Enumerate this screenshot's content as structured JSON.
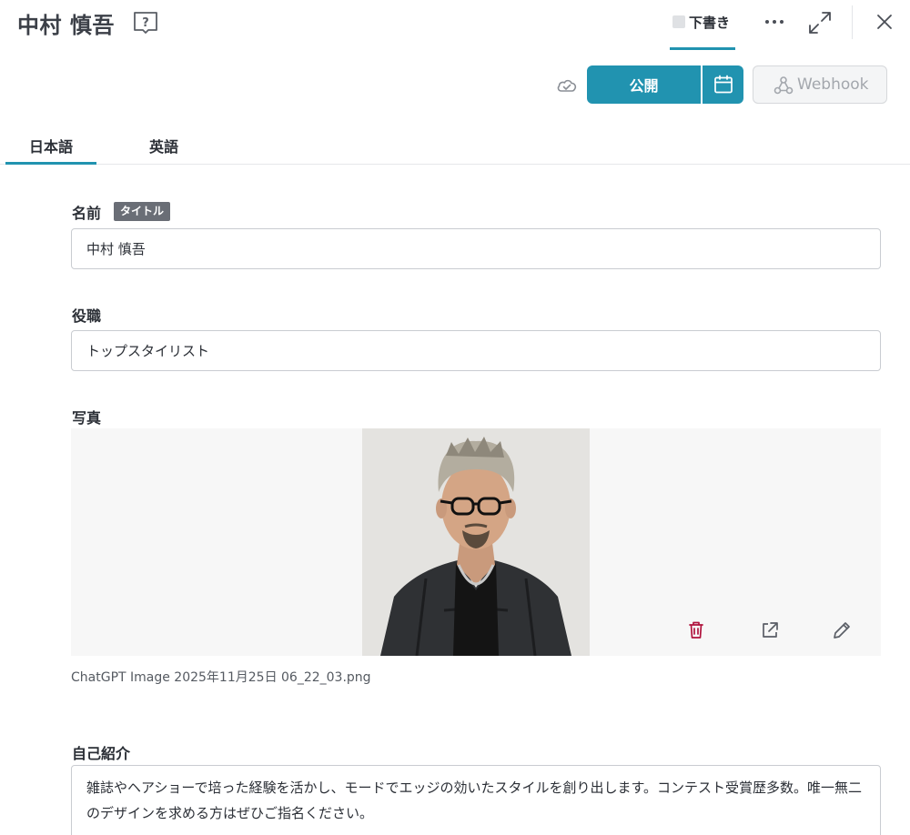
{
  "header": {
    "title": "中村 慎吾",
    "status_label": "下書き",
    "icons": [
      "help-book-icon",
      "more-icon",
      "expand-icon",
      "close-icon"
    ]
  },
  "actions": {
    "publish_label": "公開",
    "webhook_label": "Webhook",
    "icons": [
      "cloud-check-icon",
      "calendar-icon",
      "webhook-icon"
    ]
  },
  "language_tabs": [
    {
      "label": "日本語",
      "active": true
    },
    {
      "label": "英語",
      "active": false
    }
  ],
  "fields": {
    "name": {
      "label": "名前",
      "badge": "タイトル",
      "value": "中村 慎吾"
    },
    "position": {
      "label": "役職",
      "value": "トップスタイリスト"
    },
    "photo": {
      "label": "写真",
      "filename": "ChatGPT Image 2025年11月25日 06_22_03.png",
      "action_icons": [
        "trash-icon",
        "external-link-icon",
        "pencil-icon"
      ]
    },
    "bio": {
      "label": "自己紹介",
      "value": "雑誌やヘアショーで培った経験を活かし、モードでエッジの効いたスタイルを創り出します。コンテスト受賞歴多数。唯一無二のデザインを求める方はぜひご指名ください。"
    }
  },
  "colors": {
    "accent": "#2193b0",
    "danger": "#b0123c",
    "badge_bg": "#6a6e76"
  }
}
